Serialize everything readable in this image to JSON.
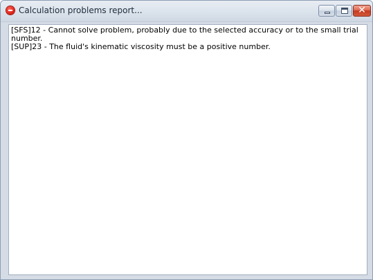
{
  "window": {
    "title": "Calculation problems report...",
    "title_icon": "error-stop-icon",
    "controls": {
      "minimize_icon": "minimize-icon",
      "maximize_icon": "maximize-icon",
      "close_icon": "close-icon",
      "close_glyph": "✕"
    }
  },
  "report": {
    "lines": [
      "[SFS]12 - Cannot solve problem, probably due to the selected accuracy or to the small trial number.",
      "[SUP]23 - The fluid's kinematic viscosity must be a positive number."
    ]
  },
  "colors": {
    "titlebar": "#dbe3ec",
    "close_button": "#c43a20",
    "error_icon": "#e0231a"
  }
}
